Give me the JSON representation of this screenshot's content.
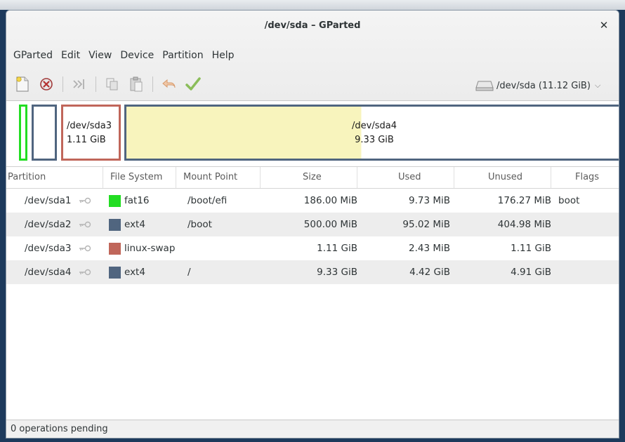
{
  "window": {
    "title": "/dev/sda – GParted"
  },
  "menubar": {
    "items": [
      "GParted",
      "Edit",
      "View",
      "Device",
      "Partition",
      "Help"
    ]
  },
  "toolbar": {
    "buttons": [
      "new-icon",
      "delete-icon",
      "resize-move-icon",
      "copy-icon",
      "paste-icon",
      "undo-icon",
      "apply-icon"
    ]
  },
  "device_selector": {
    "value": "/dev/sda  (11.12 GiB)"
  },
  "disk_map": {
    "segments": [
      {
        "name": "/dev/sda1",
        "color": "#22dd22"
      },
      {
        "name": "/dev/sda2",
        "color": "#50657f"
      },
      {
        "name": "/dev/sda3",
        "size": "1.11 GiB",
        "color": "#c0665a"
      },
      {
        "name": "/dev/sda4",
        "size": "9.33 GiB",
        "color": "#50657f",
        "used_fraction": 0.474
      }
    ]
  },
  "table": {
    "headers": [
      "Partition",
      "File System",
      "Mount Point",
      "Size",
      "Used",
      "Unused",
      "Flags"
    ],
    "rows": [
      {
        "partition": "/dev/sda1",
        "fs": "fat16",
        "fs_color": "#22dd22",
        "mount": "/boot/efi",
        "size": "186.00 MiB",
        "used": "9.73 MiB",
        "unused": "176.27 MiB",
        "flags": "boot"
      },
      {
        "partition": "/dev/sda2",
        "fs": "ext4",
        "fs_color": "#50657f",
        "mount": "/boot",
        "size": "500.00 MiB",
        "used": "95.02 MiB",
        "unused": "404.98 MiB",
        "flags": ""
      },
      {
        "partition": "/dev/sda3",
        "fs": "linux-swap",
        "fs_color": "#c0665a",
        "mount": "",
        "size": "1.11 GiB",
        "used": "2.43 MiB",
        "unused": "1.11 GiB",
        "flags": ""
      },
      {
        "partition": "/dev/sda4",
        "fs": "ext4",
        "fs_color": "#50657f",
        "mount": "/",
        "size": "9.33 GiB",
        "used": "4.42 GiB",
        "unused": "4.91 GiB",
        "flags": ""
      }
    ]
  },
  "statusbar": {
    "text": "0 operations pending"
  }
}
